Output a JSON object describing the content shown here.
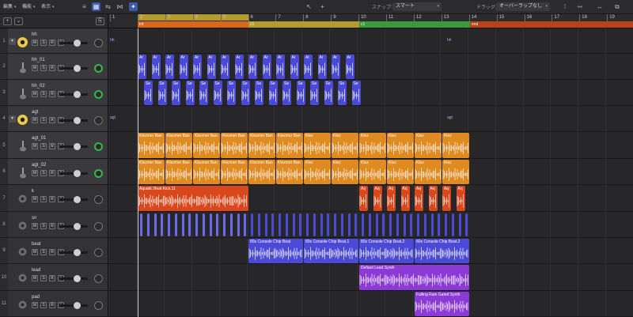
{
  "toolbar": {
    "menus": [
      {
        "label": "編集"
      },
      {
        "label": "機能"
      },
      {
        "label": "表示"
      }
    ],
    "snap_label": "スナップ:",
    "snap_value": "スマート",
    "drag_label": "ドラッグ:",
    "drag_value": "オーバーラップなし"
  },
  "ruler": {
    "bars": [
      "1",
      "2",
      "3",
      "4",
      "5",
      "6",
      "7",
      "8",
      "9",
      "10",
      "11",
      "12",
      "13",
      "14",
      "15",
      "16",
      "17",
      "18",
      "19"
    ],
    "markers": [
      {
        "label": "int",
        "color": "#d8661b"
      },
      {
        "label": "c1",
        "color": "#b59b2b"
      },
      {
        "label": "c1",
        "color": "#3a9a3a"
      },
      {
        "label": "end",
        "color": "#b8421a"
      }
    ]
  },
  "tracks": [
    {
      "num": "1",
      "name": "hh",
      "kind": "folder",
      "pan_green": false
    },
    {
      "num": "2",
      "name": "hh_01",
      "kind": "sub",
      "pan_green": true
    },
    {
      "num": "3",
      "name": "hh_02",
      "kind": "sub",
      "pan_green": true
    },
    {
      "num": "4",
      "name": "agt",
      "kind": "folder",
      "pan_green": false
    },
    {
      "num": "5",
      "name": "agt_01",
      "kind": "sub",
      "pan_green": true
    },
    {
      "num": "6",
      "name": "agt_02",
      "kind": "sub",
      "pan_green": true
    },
    {
      "num": "7",
      "name": "k",
      "kind": "inst",
      "pan_green": false
    },
    {
      "num": "8",
      "name": "sn",
      "kind": "inst",
      "pan_green": false
    },
    {
      "num": "9",
      "name": "beat",
      "kind": "inst",
      "pan_green": false
    },
    {
      "num": "10",
      "name": "lead",
      "kind": "inst",
      "pan_green": false
    },
    {
      "num": "11",
      "name": "pad",
      "kind": "inst",
      "pan_green": false
    }
  ],
  "msr": {
    "m": "M",
    "s": "S",
    "r": "R",
    "i": "I"
  },
  "lane_labels": {
    "hh": "hh",
    "agt": "agt"
  },
  "regions": {
    "hh01": "Ar",
    "hh02": "Se",
    "agt": "Klezmer Ban",
    "agt_short": "Klez",
    "kick": "Aquatic Beat Kick.11",
    "kick_short": "Aq",
    "beat": [
      "80s Console Chip Beat",
      "80s Console Chip Beat.1",
      "80s Console Chip Beat.2",
      "80s Console Chip Beat.3"
    ],
    "lead": "Defiant Lead Synth",
    "pad": "Falling Rain Gated Synth"
  },
  "colors": {
    "blue": "#4a4ad6",
    "orange": "#e08a22",
    "red": "#d9481d",
    "purple": "#8c3ad6",
    "accent": "#3b5aa8"
  }
}
